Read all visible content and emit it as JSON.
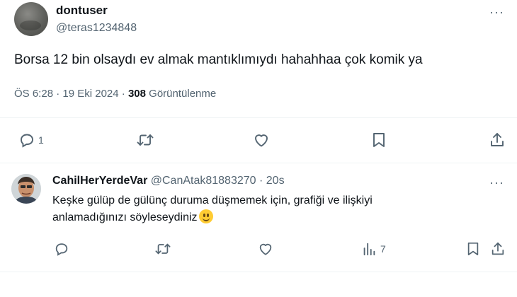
{
  "tweet": {
    "author_name": "dontuser",
    "author_handle": "@teras1234848",
    "text": "Borsa 12 bin olsaydı ev almak mantıklımıydı hahahhaa çok komik ya",
    "time": "ÖS 6:28",
    "date": "19 Eki 2024",
    "sep": "·",
    "views_count": "308",
    "views_label": "Görüntülenme",
    "reply_count": "1",
    "more_label": "···"
  },
  "reply": {
    "author_name": "CahilHerYerdeVar",
    "author_handle": "@CanAtak81883270",
    "sep": "·",
    "time": "20s",
    "text_line1": "Keşke gülüp de gülünç duruma düşmemek için, grafiği ve ilişkiyi",
    "text_line2": "anlamadığınızı söyleseydiniz",
    "views_count": "7",
    "more_label": "···"
  },
  "icons": {
    "reply": "reply-icon",
    "retweet": "retweet-icon",
    "like": "heart-icon",
    "bookmark": "bookmark-icon",
    "share": "share-icon",
    "views": "views-icon",
    "emoji": "slightly-smiling-face"
  },
  "colors": {
    "text": "#0f1419",
    "muted": "#536471",
    "divider": "#eff3f4"
  }
}
